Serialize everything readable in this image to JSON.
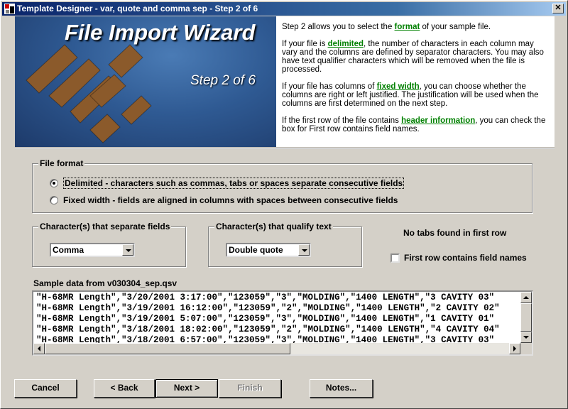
{
  "window": {
    "title": "Template Designer - var, quote and comma sep - Step 2 of 6",
    "close_label": "✕"
  },
  "banner": {
    "title": "File Import Wizard",
    "step": "Step 2 of 6"
  },
  "info": {
    "p1_before": "Step 2 allows you to select the ",
    "p1_link": "format",
    "p1_after": " of your sample file.",
    "p2_before": "If your file is ",
    "p2_link": "delimited",
    "p2_after": ", the number of characters in each column may vary and the columns are defined by separator characters.  You may also have text qualifier characters which will be removed when the file is processed.",
    "p3_before": "If your file has columns of ",
    "p3_link": "fixed width",
    "p3_after": ", you can choose whether the columns are right or left justified.  The justification will be used when the columns are first determined on the next step.",
    "p4_before": "If the first row of the file contains ",
    "p4_link": "header information",
    "p4_after": ", you can check the box for First row contains field names."
  },
  "file_format": {
    "group_label": "File format",
    "delimited_label": "Delimited - characters such as commas, tabs or spaces separate consecutive fields",
    "fixed_label": "Fixed width - fields are aligned in columns with spaces between consecutive fields",
    "selected": "delimited"
  },
  "separator": {
    "group_label": "Character(s) that separate fields",
    "value": "Comma"
  },
  "qualifier": {
    "group_label": "Character(s) that qualify text",
    "value": "Double quote"
  },
  "tabs_message": "No tabs found in first row",
  "first_row": {
    "label": "First row contains field names",
    "checked": false
  },
  "sample": {
    "label": "Sample data from v030304_sep.qsv",
    "lines": [
      "\"H-68MR Length\",\"3/20/2001 3:17:00\",\"123059\",\"3\",\"MOLDING\",\"1400 LENGTH\",\"3 CAVITY 03\"",
      "\"H-68MR Length\",\"3/19/2001 16:12:00\",\"123059\",\"2\",\"MOLDING\",\"1400 LENGTH\",\"2 CAVITY 02\"",
      "\"H-68MR Length\",\"3/19/2001 5:07:00\",\"123059\",\"3\",\"MOLDING\",\"1400 LENGTH\",\"1 CAVITY 01\"",
      "\"H-68MR Length\",\"3/18/2001 18:02:00\",\"123059\",\"2\",\"MOLDING\",\"1400 LENGTH\",\"4 CAVITY 04\"",
      "\"H-68MR Length\",\"3/18/2001 6:57:00\",\"123059\",\"3\",\"MOLDING\",\"1400 LENGTH\",\"3 CAVITY 03\""
    ]
  },
  "buttons": {
    "cancel": "Cancel",
    "back": "< Back",
    "next": "Next >",
    "finish": "Finish",
    "notes": "Notes..."
  }
}
